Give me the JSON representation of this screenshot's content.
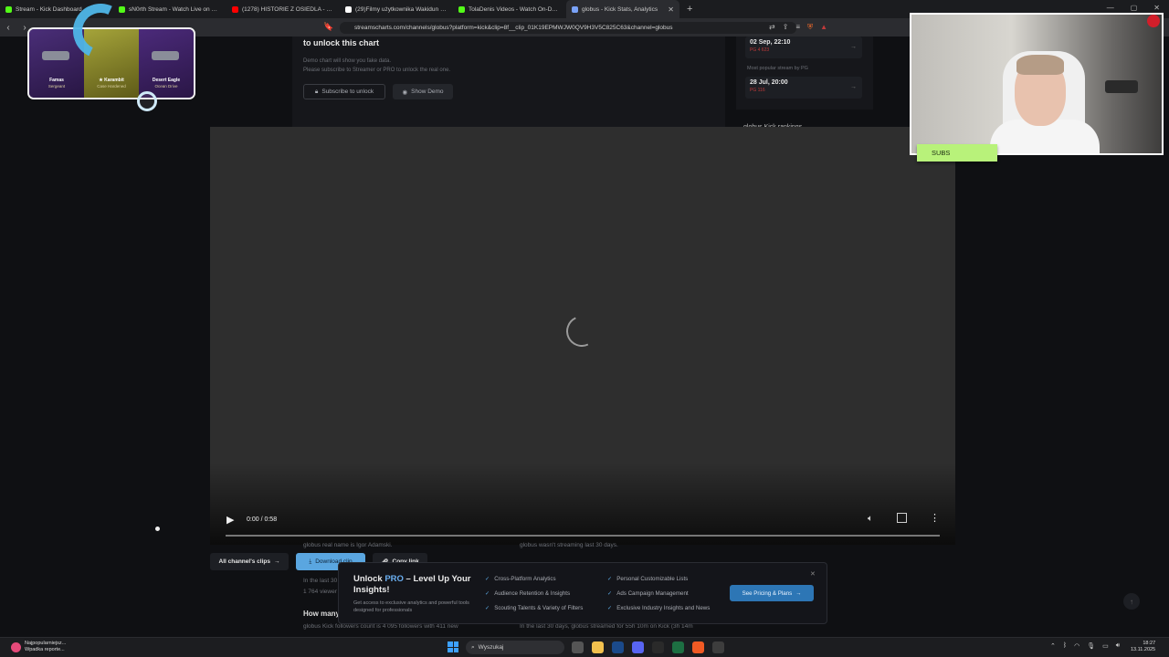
{
  "browser": {
    "tabs": [
      {
        "title": "Stream - Kick Dashboard",
        "color": "#53fc18",
        "active": false
      },
      {
        "title": "sN0rth Stream - Watch Live on Kick",
        "color": "#53fc18",
        "active": false
      },
      {
        "title": "(1278) HISTORIE Z OSIEDLA - YouTube",
        "color": "#ff0000",
        "active": false
      },
      {
        "title": "(29)Filmy użytkownika Wakidun Kloni",
        "color": "#ffffff",
        "active": false
      },
      {
        "title": "TolaDenis Videos - Watch On-Demand",
        "color": "#53fc18",
        "active": false
      },
      {
        "title": "globus - Kick Stats, Analytics",
        "color": "#7aa2f7",
        "active": true
      }
    ],
    "url": "streamscharts.com/channels/globus?platform=kick&clip=8f__clip_01K19EPMWJW0QV9H3V5C825C63&channel=globus"
  },
  "page": {
    "unlock_title": "to unlock this chart",
    "unlock_desc_1": "Demo chart will show you fake data.",
    "unlock_desc_2": "Please subscribe to Streamer or PRO to unlock the real one.",
    "subscribe_label": "Subscribe to unlock",
    "show_demo_label": "Show Demo",
    "side_cards": [
      {
        "date": "02 Sep, 22:10",
        "value": "4 623"
      },
      {
        "date": "28 Jul, 20:00",
        "value": "116"
      }
    ],
    "side_label": "Most popular stream by PG",
    "side_rank": "globus Kick rankings",
    "below_left_1": "globus real name is Igor Adamski.",
    "below_left_2": "In the last 30",
    "below_left_3": "1 764 viewer",
    "below_heading": "How many",
    "below_left_4": "globus Kick followers count is 4 095 followers with 411 new",
    "below_right_1": "globus wasn't streaming last 30 days.",
    "below_right_2": "In the last 30 days, globus streamed for 55h 10m on Kick (3h 14m"
  },
  "video": {
    "time": "0:00 / 0:58"
  },
  "clip_actions": {
    "all_clips": "All channel's clips",
    "download": "Download clip",
    "copy_link": "Copy link"
  },
  "promo": {
    "title_pre": "Unlock ",
    "title_pro": "PRO",
    "title_post": " – Level Up Your Insights!",
    "desc": "Get access to exclusive analytics and powerful tools designed for professionals",
    "features": [
      "Cross-Platform Analytics",
      "Personal Customizable Lists",
      "Audience Retention & Insights",
      "Ads Campaign Management",
      "Scouting Talents & Variety of Filters",
      "Exclusive Industry Insights and News"
    ],
    "cta": "See Pricing & Plans"
  },
  "overlay": {
    "skins": [
      {
        "name": "Famas",
        "sub": "Sergeant"
      },
      {
        "name": "★ Karambit",
        "sub": "Case Hardened"
      },
      {
        "name": "Desert Eagle",
        "sub": "Ocean Drive"
      }
    ],
    "subs_label": "SUBS"
  },
  "taskbar": {
    "news_1": "Najpopularniejsz...",
    "news_2": "Wpadka reporte...",
    "search": "Wyszukaj",
    "time": "18:27",
    "date": "13.11.2025"
  }
}
